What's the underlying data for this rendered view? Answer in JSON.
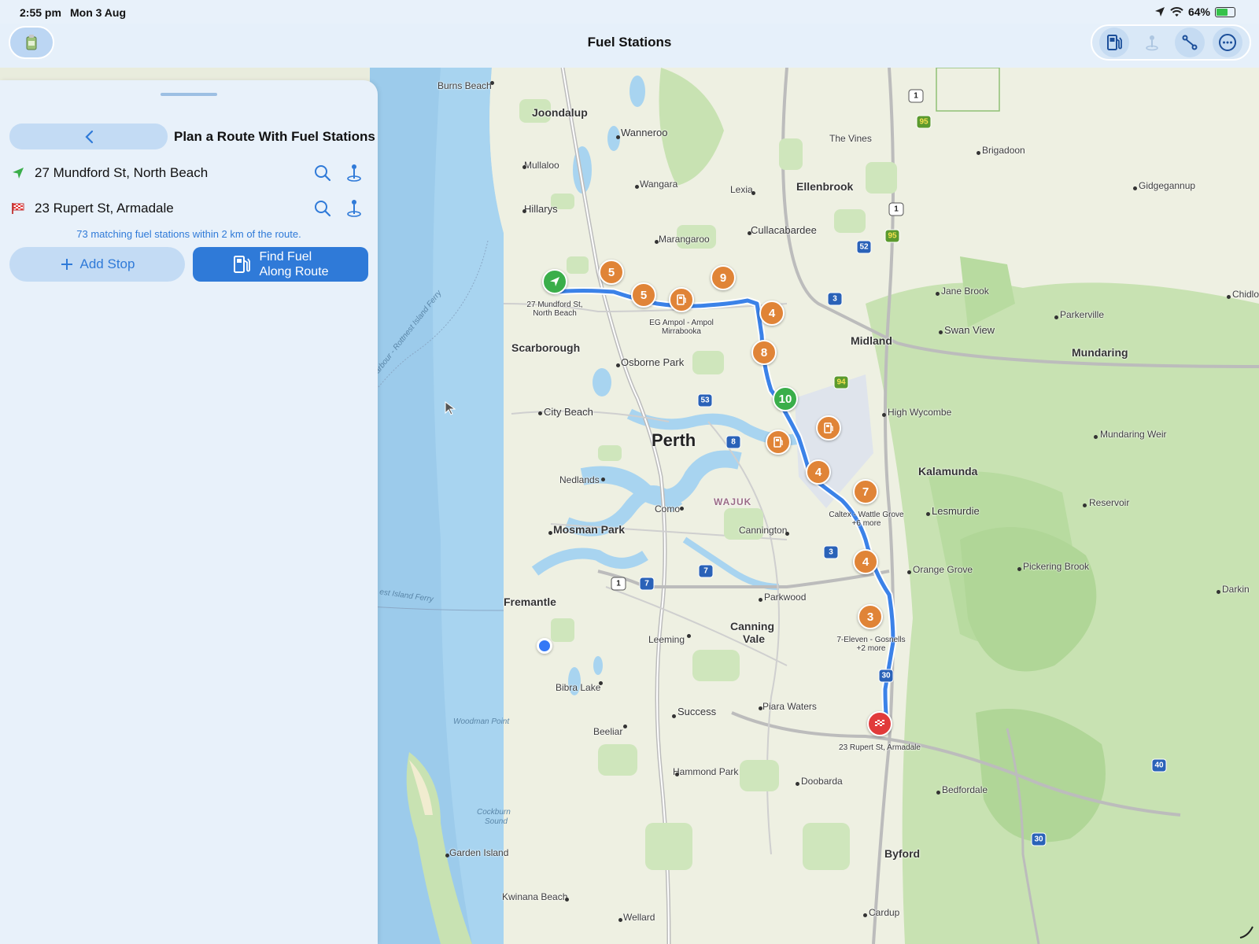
{
  "status_bar": {
    "time": "2:55 pm",
    "date": "Mon 3 Aug",
    "battery": "64%",
    "battery_level": 0.64
  },
  "nav": {
    "title": "Fuel Stations",
    "app_icon": "fuel-can-icon",
    "toolbar": [
      {
        "name": "fuel-pump-icon",
        "enabled": true
      },
      {
        "name": "pin-icon",
        "enabled": false
      },
      {
        "name": "route-icon",
        "enabled": true
      },
      {
        "name": "more-icon",
        "enabled": true
      }
    ]
  },
  "panel": {
    "title": "Plan a Route With Fuel Stations",
    "origin": "27 Mundford St, North Beach",
    "destination": "23 Rupert St, Armadale",
    "match_text": "73 matching fuel stations within 2 km of the route.",
    "add_stop_label": "Add Stop",
    "find_fuel_line1": "Find Fuel",
    "find_fuel_line2": "Along Route"
  },
  "map": {
    "places": {
      "burns_beach": "Burns Beach",
      "joondalup": "Joondalup",
      "wanneroo": "Wanneroo",
      "mullaloo": "Mullaloo",
      "wangara": "Wangara",
      "lexia": "Lexia",
      "ellenbrook": "Ellenbrook",
      "the_vines": "The Vines",
      "brigadoon": "Brigadoon",
      "gidgegannup": "Gidgegannup",
      "hillarys": "Hillarys",
      "cullacabardee": "Cullacabardee",
      "marangaroo": "Marangaroo",
      "jane_brook": "Jane Brook",
      "parkerville": "Parkerville",
      "chidlow": "Chidlo",
      "swan_view": "Swan View",
      "midland": "Midland",
      "mundaring": "Mundaring",
      "scarborough": "Scarborough",
      "osborne_park": "Osborne Park",
      "high_wycombe": "High Wycombe",
      "city_beach": "City Beach",
      "perth": "Perth",
      "mundaring_weir": "Mundaring Weir",
      "kalamunda": "Kalamunda",
      "nedlands": "Nedlands",
      "wajuk": "WAJUK",
      "reservoir": "Reservoir",
      "como": "Como",
      "lesmurdie": "Lesmurdie",
      "mosman_park": "Mosman Park",
      "cannington": "Cannington",
      "orange_grove": "Orange Grove",
      "pickering_brook": "Pickering Brook",
      "darkin": "Darkin",
      "parkwood": "Parkwood",
      "fremantle": "Fremantle",
      "rottnest_ferry_1": "Harbour - Rottnest Island Ferry",
      "rottnest_ferry_2": "est Island Ferry",
      "leeming": "Leeming",
      "canning_vale_1": "Canning",
      "canning_vale_2": "Vale",
      "bibra_lake": "Bibra Lake",
      "beeliar": "Beeliar",
      "success": "Success",
      "piara_waters": "Piara Waters",
      "woodman_point": "Woodman Point",
      "hammond_park": "Hammond Park",
      "doobarda": "Doobarda",
      "bedfordale": "Bedfordale",
      "cockburn_sound_1": "Cockburn",
      "cockburn_sound_2": "Sound",
      "garden_island": "Garden Island",
      "byford": "Byford",
      "kwinana_beach": "Kwinana Beach",
      "wellard": "Wellard",
      "cardup": "Cardup"
    },
    "shields": [
      "1",
      "1",
      "1",
      "95",
      "95",
      "52",
      "3",
      "94",
      "53",
      "8",
      "3",
      "7",
      "7",
      "1",
      "30",
      "40",
      "30"
    ],
    "route_labels": {
      "start_1": "27 Mundford St,",
      "start_2": "North Beach",
      "ampol_1": "EG Ampol - Ampol",
      "ampol_2": "Mirrabooka",
      "caltex_1": "Caltex - Wattle Grove",
      "caltex_2": "+6 more",
      "seven_1": "7-Eleven - Gosnells",
      "seven_2": "+2 more",
      "end": "23 Rupert St, Armadale"
    },
    "clusters": [
      "5",
      "5",
      "9",
      "4",
      "8",
      "10",
      "4",
      "7",
      "4",
      "3"
    ],
    "colors": {
      "route": "#3b82e8",
      "cluster": "#e08437",
      "start": "#3aae4a",
      "end": "#e13a3a",
      "water": "#a8d4f0",
      "park": "#b8dba0"
    }
  }
}
